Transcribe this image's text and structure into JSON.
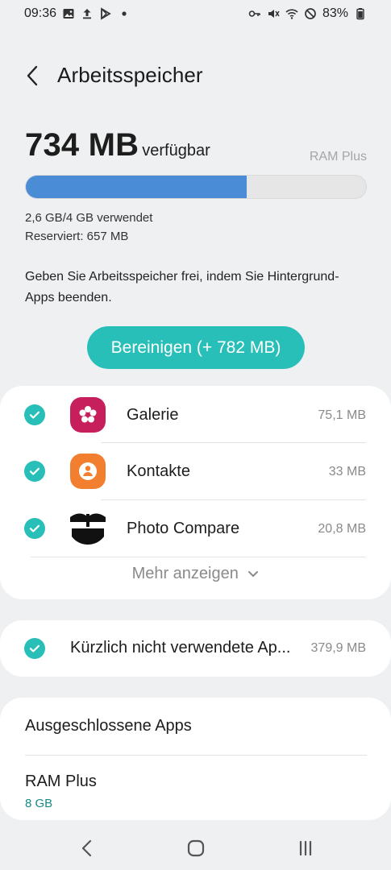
{
  "status_bar": {
    "time": "09:36",
    "battery": "83%",
    "left_icons": [
      "gallery-icon",
      "upload-icon",
      "play-store-icon",
      "dot-icon"
    ],
    "right_icons": [
      "key-icon",
      "mute-icon",
      "wifi-icon",
      "dnd-icon",
      "battery-icon"
    ]
  },
  "header": {
    "title": "Arbeitsspeicher"
  },
  "memory": {
    "available_value": "734 MB",
    "available_label": "verfügbar",
    "ram_plus_label": "RAM Plus",
    "used_fraction": 0.65,
    "used_text": "2,6 GB/4 GB verwendet",
    "reserved_text": "Reserviert: 657 MB",
    "colors": {
      "bar_fill": "#4a8cd6",
      "bar_track": "#e6e6e6"
    }
  },
  "info_text": "Geben Sie Arbeitsspeicher frei, indem Sie Hintergrund-Apps beenden.",
  "clean_button": {
    "label": "Bereinigen (+ 782 MB)",
    "color": "#28bfb9"
  },
  "apps": [
    {
      "name": "Galerie",
      "size": "75,1 MB",
      "icon": "gallery-flower-icon",
      "checked": true
    },
    {
      "name": "Kontakte",
      "size": "33 MB",
      "icon": "contacts-icon",
      "checked": true
    },
    {
      "name": "Photo Compare",
      "size": "20,8 MB",
      "icon": "photo-compare-icon",
      "checked": true
    }
  ],
  "more_label": "Mehr anzeigen",
  "recent_unused": {
    "label": "Kürzlich nicht verwendete Ap...",
    "size": "379,9 MB",
    "checked": true
  },
  "excluded_apps_label": "Ausgeschlossene Apps",
  "ram_plus": {
    "label": "RAM Plus",
    "value": "8 GB"
  },
  "nav": {
    "icons": [
      "back-icon",
      "home-icon",
      "recents-icon"
    ]
  }
}
